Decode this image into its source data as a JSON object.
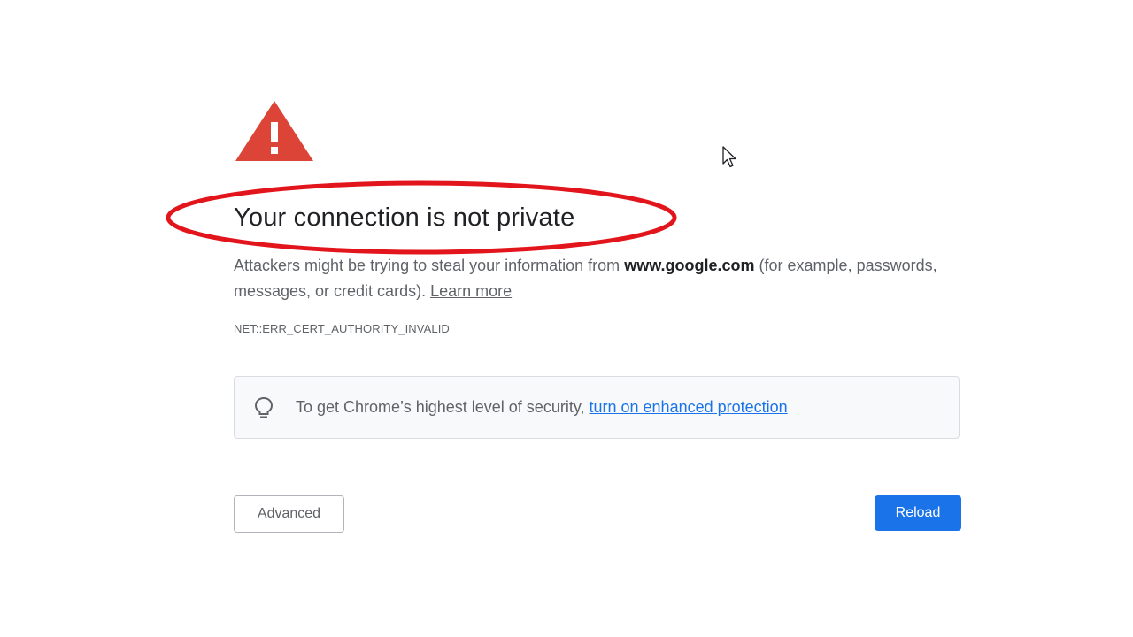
{
  "error_page": {
    "title": "Your connection is not private",
    "description": {
      "before_domain": "Attackers might be trying to steal your information from ",
      "domain": "www.google.com",
      "after_domain": " (for example, passwords, messages, or credit cards). ",
      "learn_more": "Learn more"
    },
    "error_code": "NET::ERR_CERT_AUTHORITY_INVALID",
    "security_banner": {
      "text": "To get Chrome’s highest level of security, ",
      "link": "turn on enhanced protection"
    },
    "buttons": {
      "advanced": "Advanced",
      "reload": "Reload"
    }
  },
  "icons": {
    "warning": "warning-triangle-icon",
    "lightbulb": "lightbulb-icon",
    "cursor": "mouse-cursor-icon"
  },
  "colors": {
    "warning_red": "#db4437",
    "annotation_red": "#e3151c",
    "link_blue": "#1a73e8",
    "reload_blue": "#1a73e8"
  }
}
